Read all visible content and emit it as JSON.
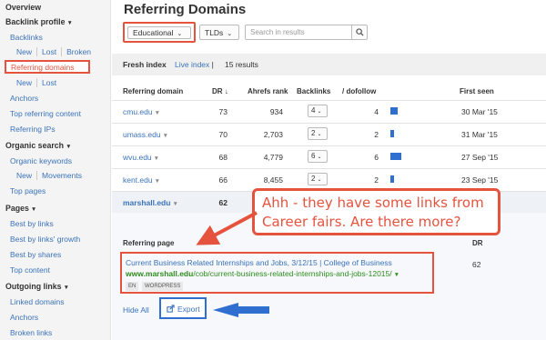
{
  "sidebar": {
    "overview": "Overview",
    "backlink_profile": "Backlink profile",
    "backlinks": "Backlinks",
    "backlinks_sub": [
      "New",
      "Lost",
      "Broken"
    ],
    "referring_domains": "Referring domains",
    "referring_domains_sub": [
      "New",
      "Lost"
    ],
    "anchors": "Anchors",
    "top_referring_content": "Top referring content",
    "referring_ips": "Referring IPs",
    "organic_search": "Organic search",
    "organic_keywords": "Organic keywords",
    "organic_keywords_sub": [
      "New",
      "Movements"
    ],
    "top_pages": "Top pages",
    "pages": "Pages",
    "best_by_links": "Best by links",
    "best_by_links_growth": "Best by links' growth",
    "best_by_shares": "Best by shares",
    "top_content": "Top content",
    "outgoing_links": "Outgoing links",
    "linked_domains": "Linked domains",
    "anchors_out": "Anchors",
    "broken_links": "Broken links"
  },
  "main": {
    "title": "Referring Domains",
    "filters": {
      "type_selected": "Educational",
      "tlds": "TLDs",
      "search_placeholder": "Search in results"
    },
    "index_bar": {
      "fresh_index": "Fresh index",
      "live_index": "Live index",
      "separator": "|",
      "results": "15 results"
    },
    "columns": [
      "Referring domain",
      "DR",
      "Ahrefs rank",
      "Backlinks",
      "/ dofollow",
      "First seen"
    ],
    "rows": [
      {
        "domain": "cmu.edu",
        "dr": "73",
        "rank": "934",
        "backlinks": "4",
        "dofollow": "4",
        "dofollow_value": 4,
        "first_seen": "30 Mar '15"
      },
      {
        "domain": "umass.edu",
        "dr": "70",
        "rank": "2,703",
        "backlinks": "2",
        "dofollow": "2",
        "dofollow_value": 2,
        "first_seen": "31 Mar '15"
      },
      {
        "domain": "wvu.edu",
        "dr": "68",
        "rank": "4,779",
        "backlinks": "6",
        "dofollow": "6",
        "dofollow_value": 6,
        "first_seen": "27 Sep '15"
      },
      {
        "domain": "kent.edu",
        "dr": "66",
        "rank": "8,455",
        "backlinks": "2",
        "dofollow": "2",
        "dofollow_value": 2,
        "first_seen": "23 Sep '15"
      },
      {
        "domain": "marshall.edu",
        "dr": "62",
        "rank": "",
        "backlinks": "",
        "dofollow": "",
        "dofollow_value": 0,
        "first_seen": ""
      }
    ],
    "expanded": {
      "referring_page_header": "Referring page",
      "dr_header": "DR",
      "page_title": "Current Business Related Internships and Jobs, 3/12/15 | College of Business",
      "url_domain": "www.marshall.edu",
      "url_path": "/cob/current-business-related-internships-and-jobs-12015/",
      "tags": [
        "EN",
        "WORDPRESS"
      ],
      "dr_value": "62",
      "hide_all": "Hide All",
      "export": "Export"
    }
  },
  "callout": {
    "line1": "Ahh - they have some links from",
    "line2": "Career fairs. Are there more?"
  },
  "colors": {
    "annotation_red": "#e5533f",
    "annotation_blue": "#2e6fcf",
    "link_blue": "#3b73b9",
    "url_green": "#2f8c1f"
  }
}
